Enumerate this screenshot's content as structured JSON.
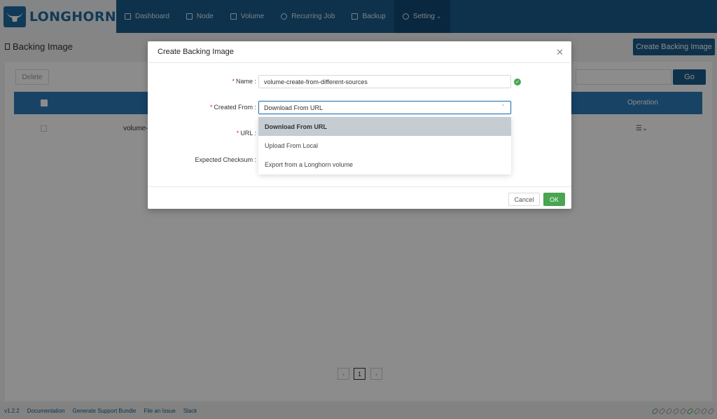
{
  "header": {
    "logo_text": "LONGHORN",
    "nav": [
      {
        "label": "Dashboard"
      },
      {
        "label": "Node"
      },
      {
        "label": "Volume"
      },
      {
        "label": "Recurring Job"
      },
      {
        "label": "Backup"
      },
      {
        "label": "Setting"
      }
    ]
  },
  "page": {
    "title": "Backing Image",
    "create_button": "Create Backing Image",
    "delete_button": "Delete",
    "go_button": "Go",
    "table_operation_header": "Operation",
    "row_name": "volume-",
    "current_page": "1"
  },
  "modal": {
    "title": "Create Backing Image",
    "name_label": "Name",
    "name_value": "volume-create-from-different-sources",
    "created_from_label": "Created From",
    "created_from_value": "Download From URL",
    "url_label": "URL",
    "checksum_label": "Expected Checksum",
    "cancel_button": "Cancel",
    "ok_button": "OK",
    "options": [
      {
        "label": "Download From URL"
      },
      {
        "label": "Upload From Local"
      },
      {
        "label": "Export from a Longhorn volume"
      }
    ]
  },
  "footer": {
    "links": [
      {
        "label": "v1.2.2"
      },
      {
        "label": "Documentation"
      },
      {
        "label": "Generate Support Bundle"
      },
      {
        "label": "File an Issue"
      },
      {
        "label": "Slack"
      }
    ]
  },
  "colors": {
    "primary": "#1a5b8a",
    "table_header": "#2d7ab8",
    "success": "#48a650",
    "required": "#f5222d"
  }
}
